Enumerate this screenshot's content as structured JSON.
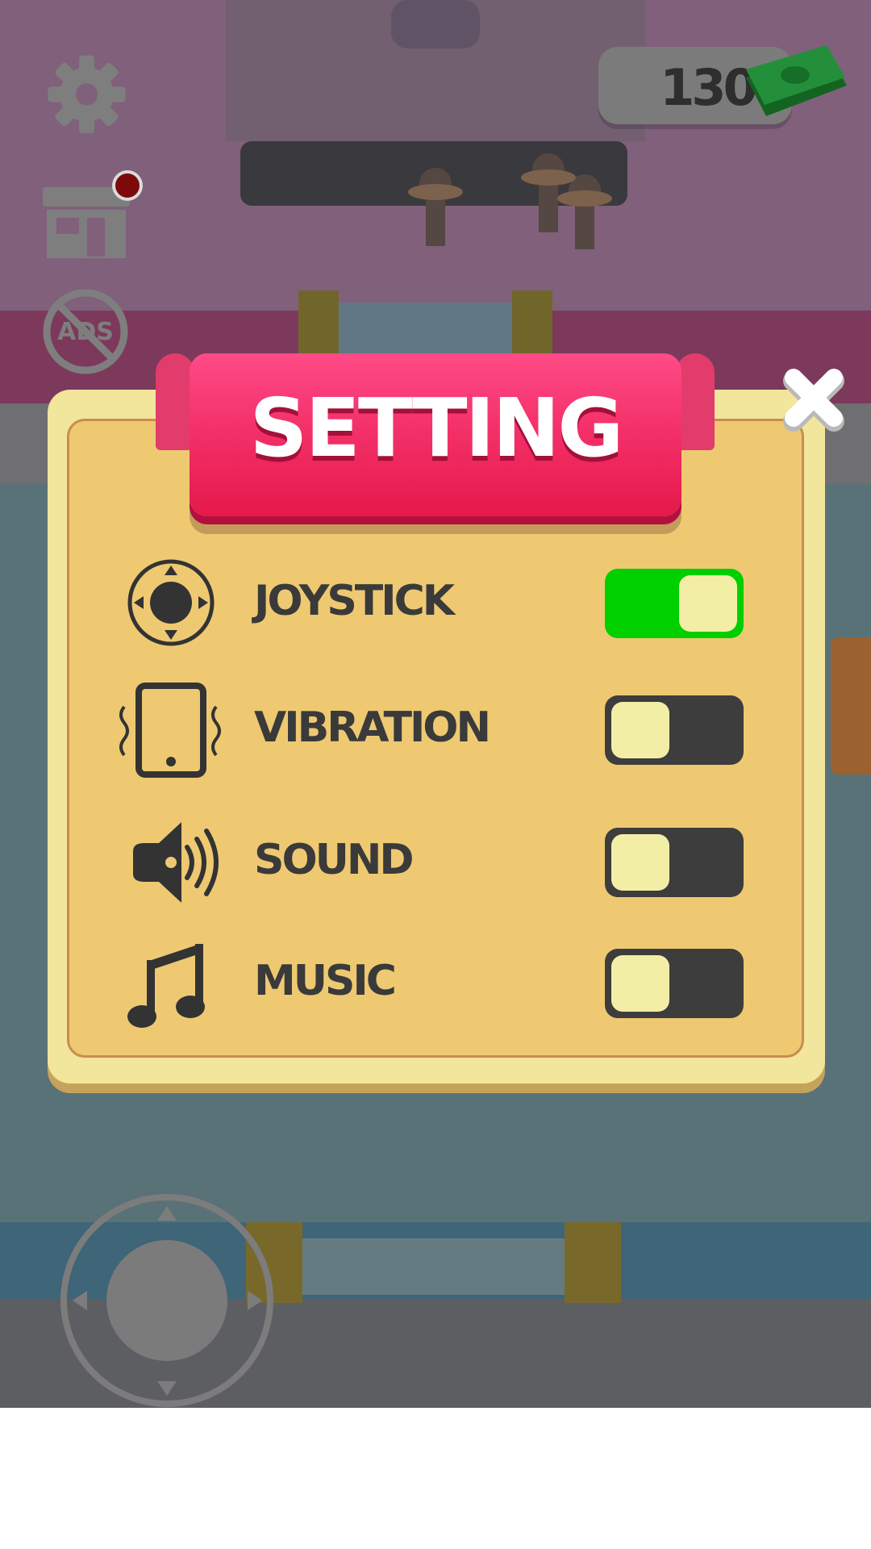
{
  "hud": {
    "money": "130",
    "shop_badge_color": "#8b0000"
  },
  "settings": {
    "title": "SETTING",
    "rows": [
      {
        "label": "JOYSTICK",
        "icon": "joystick-icon",
        "on": true
      },
      {
        "label": "VIBRATION",
        "icon": "phone-vibration-icon",
        "on": false
      },
      {
        "label": "SOUND",
        "icon": "speaker-icon",
        "on": false
      },
      {
        "label": "MUSIC",
        "icon": "music-note-icon",
        "on": false
      }
    ]
  },
  "colors": {
    "toggle_on": "#00d000",
    "toggle_off": "#3d3d3d",
    "ribbon": "#f4316a",
    "panel": "#eec972"
  }
}
